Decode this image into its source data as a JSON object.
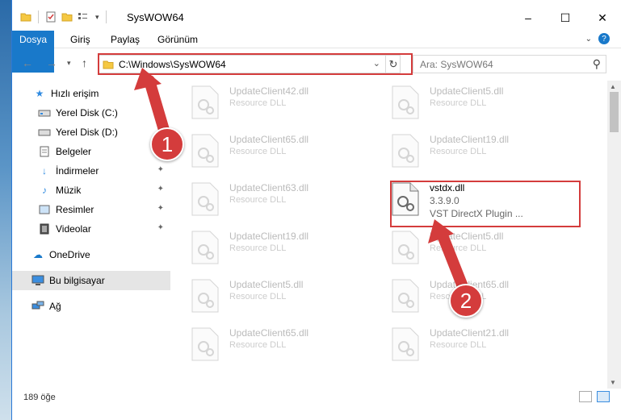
{
  "window": {
    "title": "SysWOW64",
    "controls": [
      "–",
      "☐",
      "✕"
    ]
  },
  "ribbon": {
    "tabs": [
      "Dosya",
      "Giriş",
      "Paylaş",
      "Görünüm"
    ]
  },
  "nav": {
    "path": "C:\\Windows\\SysWOW64",
    "search_placeholder": "Ara: SysWOW64"
  },
  "sidebar": {
    "items": [
      {
        "label": "Hızlı erişim",
        "icon": "star-icon"
      },
      {
        "label": "Yerel Disk (C:)",
        "icon": "drive-icon"
      },
      {
        "label": "Yerel Disk (D:)",
        "icon": "drive-icon"
      },
      {
        "label": "Belgeler",
        "icon": "documents-icon"
      },
      {
        "label": "İndirmeler",
        "icon": "download-icon"
      },
      {
        "label": "Müzik",
        "icon": "music-icon"
      },
      {
        "label": "Resimler",
        "icon": "pictures-icon"
      },
      {
        "label": "Videolar",
        "icon": "videos-icon"
      },
      {
        "label": "OneDrive",
        "icon": "cloud-icon"
      },
      {
        "label": "Bu bilgisayar",
        "icon": "computer-icon"
      },
      {
        "label": "Ağ",
        "icon": "network-icon"
      }
    ]
  },
  "files": {
    "left": [
      {
        "name": "UpdateClient42.dll",
        "type": "Resource DLL"
      },
      {
        "name": "UpdateClient65.dll",
        "type": "Resource DLL"
      },
      {
        "name": "UpdateClient63.dll",
        "type": "Resource DLL"
      },
      {
        "name": "UpdateClient19.dll",
        "type": "Resource DLL"
      },
      {
        "name": "UpdateClient5.dll",
        "type": "Resource DLL"
      },
      {
        "name": "UpdateClient65.dll",
        "type": "Resource DLL"
      }
    ],
    "right": [
      {
        "name": "UpdateClient5.dll",
        "type": "Resource DLL"
      },
      {
        "name": "UpdateClient19.dll",
        "type": "Resource DLL"
      },
      {
        "name": "vstdx.dll",
        "version": "3.3.9.0",
        "description": "VST DirectX Plugin ..."
      },
      {
        "name": "UpdateClient5.dll",
        "type": "Resource DLL"
      },
      {
        "name": "UpdateClient65.dll",
        "type": "Resource DLL"
      },
      {
        "name": "UpdateClient21.dll",
        "type": "Resource DLL"
      }
    ]
  },
  "status": {
    "count": "189 öğe"
  },
  "annotations": {
    "step1": "1",
    "step2": "2",
    "color": "#d43c3c"
  }
}
